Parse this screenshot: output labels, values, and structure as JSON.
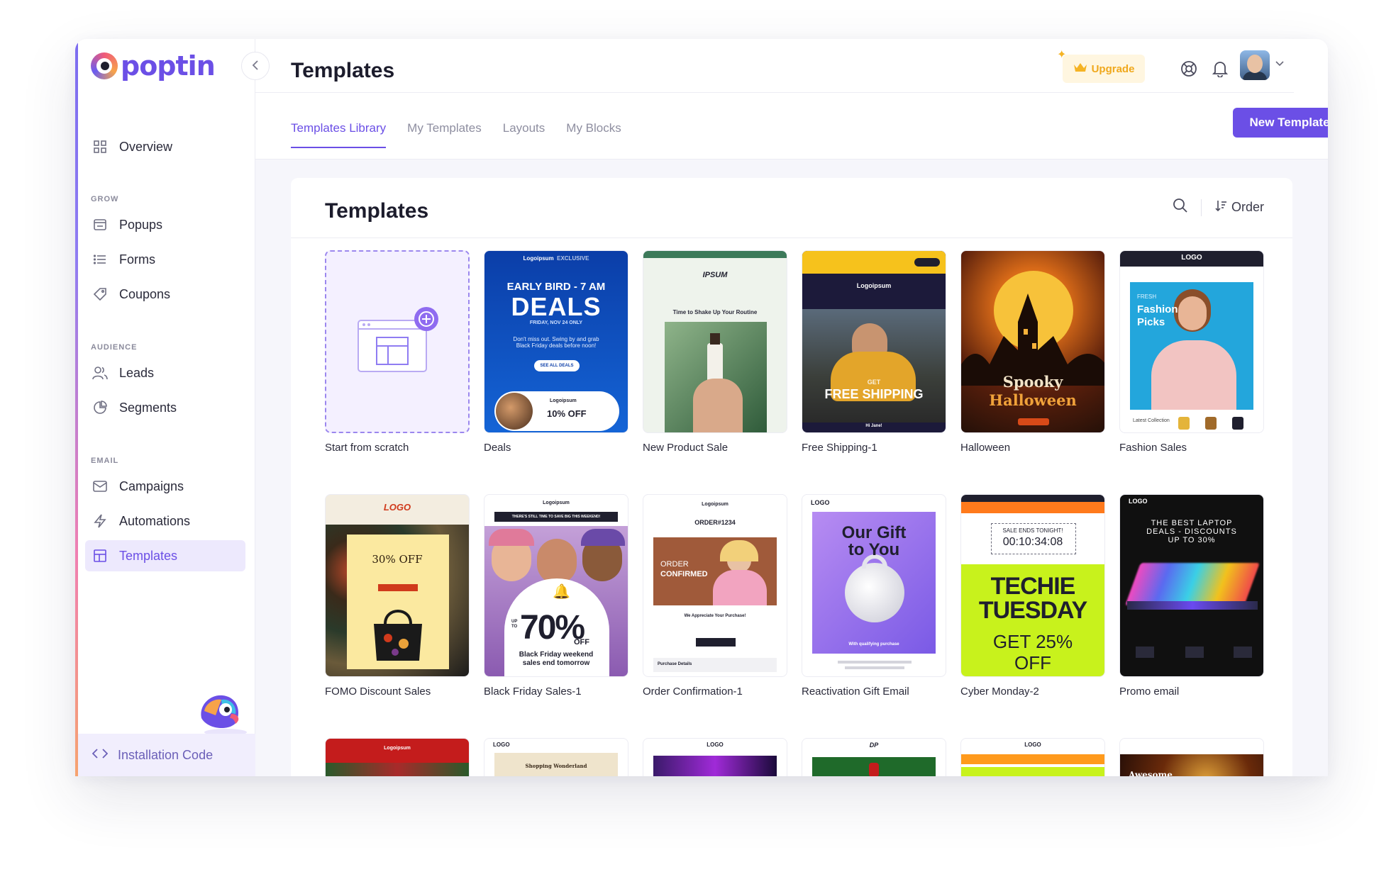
{
  "app": {
    "logo_text": "poptin",
    "page_title": "Templates"
  },
  "sidebar": {
    "items": [
      {
        "label": "Overview",
        "icon": "grid-icon"
      },
      {
        "label": "Popups",
        "icon": "popup-icon"
      },
      {
        "label": "Forms",
        "icon": "list-icon"
      },
      {
        "label": "Coupons",
        "icon": "tag-icon"
      },
      {
        "label": "Leads",
        "icon": "users-icon"
      },
      {
        "label": "Segments",
        "icon": "pie-icon"
      },
      {
        "label": "Campaigns",
        "icon": "mail-icon"
      },
      {
        "label": "Automations",
        "icon": "bolt-icon"
      },
      {
        "label": "Templates",
        "icon": "template-icon",
        "active": true
      }
    ],
    "sections": {
      "grow": "GROW",
      "audience": "AUDIENCE",
      "email": "EMAIL"
    },
    "install_label": "Installation Code"
  },
  "header": {
    "upgrade_label": "Upgrade",
    "tabs": [
      "Templates Library",
      "My Templates",
      "Layouts",
      "My Blocks"
    ],
    "new_template_label": "New Template"
  },
  "panel": {
    "title": "Templates",
    "order_label": "Order"
  },
  "templates": [
    {
      "label": "Start from scratch"
    },
    {
      "label": "Deals",
      "brand": "Logoipsum",
      "tag": "EXCLUSIVE",
      "line1": "EARLY BIRD - 7 AM",
      "headline": "DEALS",
      "date": "FRIDAY, NOV 24 ONLY",
      "body": "Don't miss out. Swing by and grab Black Friday deals before noon!",
      "cta": "SEE ALL DEALS",
      "coupon_brand": "Logoipsum",
      "coupon": "10% OFF"
    },
    {
      "label": "New Product Sale",
      "brand": "IPSUM",
      "tagline": "Time to Shake Up Your Routine"
    },
    {
      "label": "Free Shipping-1",
      "brand": "Logoipsum",
      "small": "GET",
      "headline": "FREE SHIPPING",
      "footer": "Hi Jane!"
    },
    {
      "label": "Halloween",
      "line1": "Spooky",
      "line2": "Halloween"
    },
    {
      "label": "Fashion Sales",
      "brand": "LOGO",
      "small": "FRESH",
      "line1": "Fashion",
      "line2": "Picks",
      "footer": "Latest Collection"
    },
    {
      "label": "FOMO Discount Sales",
      "brand": "LOGO",
      "headline": "30% OFF"
    },
    {
      "label": "Black Friday Sales-1",
      "brand": "Logoipsum",
      "banner": "THERE'S STILL TIME TO SAVE BIG THIS WEEKEND!",
      "upto": "UP TO",
      "headline": "70%",
      "off": "OFF",
      "footer1": "Black Friday weekend",
      "footer2": "sales end tomorrow"
    },
    {
      "label": "Order Confirmation-1",
      "brand": "Logoipsum",
      "order": "ORDER#1234",
      "line1": "ORDER",
      "line2": "CONFIRMED",
      "body": "We Appreciate Your Purchase!",
      "footer": "Purchase Details"
    },
    {
      "label": "Reactivation Gift Email",
      "brand": "LOGO",
      "line1": "Our Gift",
      "line2": "to You",
      "footer": "With qualifying purchase"
    },
    {
      "label": "Cyber Monday-2",
      "sale": "SALE ENDS TONIGHT!",
      "timer": "00:10:34:08",
      "line1": "TECHIE",
      "line2": "TUESDAY",
      "line3": "GET 25%",
      "line4": "OFF"
    },
    {
      "label": "Promo email",
      "brand": "LOGO",
      "line1": "THE BEST LAPTOP",
      "line2": "DEALS - DISCOUNTS",
      "line3": "UP TO 30%"
    }
  ],
  "row3": [
    {
      "brand": "Logoipsum"
    },
    {
      "brand": "LOGO",
      "sub": "Shopping Wonderland"
    },
    {
      "brand": "LOGO"
    },
    {
      "brand": "DP"
    },
    {
      "brand": "LOGO"
    },
    {
      "brand": "Awesome"
    }
  ],
  "colors": {
    "accent": "#6b4fe6",
    "upgrade": "#f0a81c",
    "sidebar_active_bg": "#ede9fd"
  }
}
